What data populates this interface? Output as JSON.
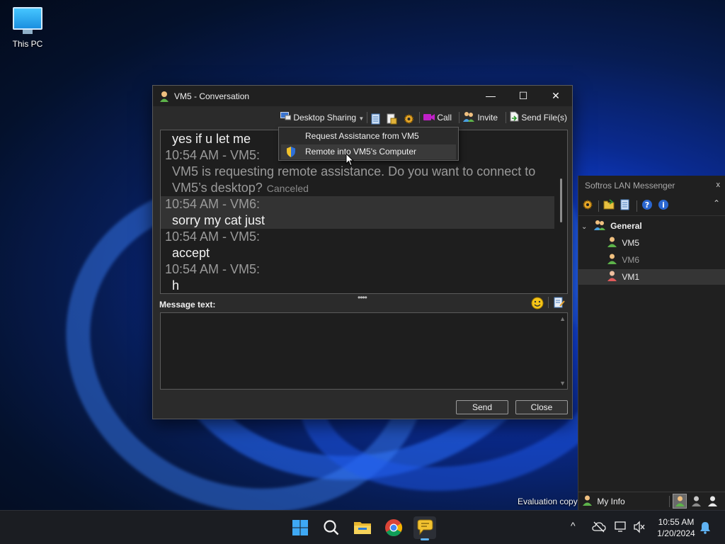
{
  "desktop": {
    "icon_label": "This PC"
  },
  "window": {
    "title": "VM5 - Conversation",
    "controls": {
      "minimize": "—",
      "maximize": "☐",
      "close": "✕"
    },
    "toolbar": {
      "desktop_sharing": "Desktop Sharing",
      "call": "Call",
      "invite": "Invite",
      "send_files": "Send File(s)"
    },
    "messages": [
      {
        "text": "yes if u let me"
      },
      {
        "timestamp": "10:54 AM - VM5:"
      },
      {
        "text": "VM5 is requesting remote assistance. Do you want to connect to"
      },
      {
        "text": "VM5’s desktop?",
        "status": "Canceled"
      },
      {
        "timestamp": "10:54 AM - VM6:"
      },
      {
        "text": "sorry my cat just"
      },
      {
        "timestamp": "10:54 AM - VM5:"
      },
      {
        "text": "accept"
      },
      {
        "timestamp": "10:54 AM - VM5:"
      },
      {
        "text": "h"
      }
    ],
    "message_label": "Message text:",
    "message_value": "",
    "send_button": "Send",
    "close_button": "Close"
  },
  "dropdown": {
    "items": [
      {
        "label": "Request Assistance from VM5"
      },
      {
        "label": "Remote into VM5's Computer"
      }
    ],
    "selected": 1
  },
  "lan_messenger": {
    "title": "Softros LAN Messenger",
    "close": "x",
    "group": "General",
    "users": [
      "VM5",
      "VM6",
      "VM1"
    ],
    "my_info": "My Info",
    "evaluation": "Evaluation copy"
  },
  "taskbar": {
    "time": "10:55 AM",
    "date": "1/20/2024",
    "tray_chevron": "^"
  },
  "colors": {
    "accent": "#5fb2f2",
    "window_bg": "#2b2b2b",
    "chat_bg": "#1e1e1e"
  }
}
